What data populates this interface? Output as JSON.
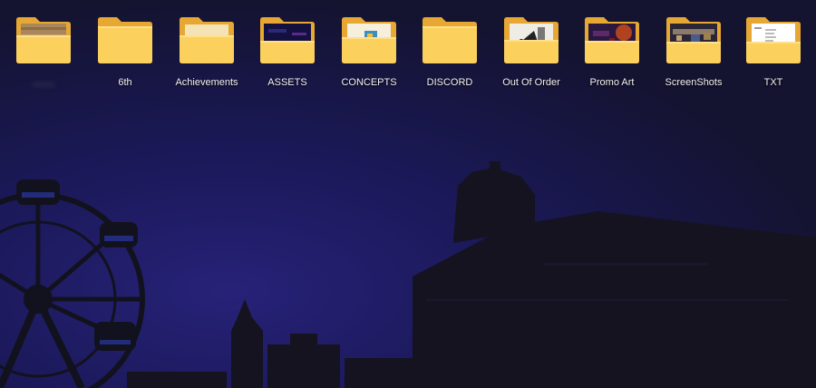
{
  "desktop": {
    "folders": [
      {
        "label": "........",
        "icon": "folder-with-photo-icon",
        "blurred": true
      },
      {
        "label": "6th",
        "icon": "folder-icon",
        "blurred": false
      },
      {
        "label": "Achievements",
        "icon": "folder-icon",
        "blurred": false
      },
      {
        "label": "ASSETS",
        "icon": "folder-with-dark-preview-icon",
        "blurred": false
      },
      {
        "label": "CONCEPTS",
        "icon": "folder-with-images-icon",
        "blurred": false
      },
      {
        "label": "DISCORD",
        "icon": "folder-icon",
        "blurred": false
      },
      {
        "label": "Out Of Order",
        "icon": "folder-with-images-icon",
        "blurred": false
      },
      {
        "label": "Promo Art",
        "icon": "folder-with-art-preview-icon",
        "blurred": false
      },
      {
        "label": "ScreenShots",
        "icon": "folder-with-screenshot-preview-icon",
        "blurred": false
      },
      {
        "label": "TXT",
        "icon": "folder-with-document-preview-icon",
        "blurred": false
      }
    ]
  },
  "colors": {
    "folder_back": "#e6a833",
    "folder_front": "#fcd05c",
    "folder_front_light": "#ffdb70",
    "wallpaper_sky": "#1c1a55",
    "wallpaper_silhouette": "#121220"
  }
}
